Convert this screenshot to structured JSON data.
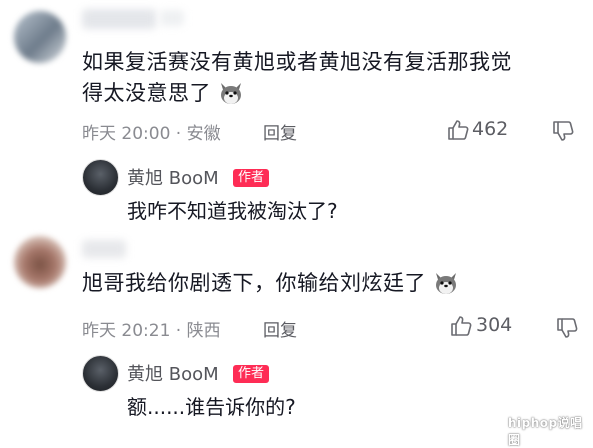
{
  "comments": [
    {
      "text_lines": [
        "如果复活赛没有黄旭或者黄旭没有复活那我觉",
        "得太没意思了"
      ],
      "emoji": "dog-emoji",
      "time": "昨天 20:00",
      "location": "安徽",
      "reply_label": "回复",
      "likes": "462",
      "reply": {
        "name": "黄旭 BooM",
        "badge": "作者",
        "text": "我咋不知道我被淘汰了?"
      }
    },
    {
      "text_lines": [
        "旭哥我给你剧透下，你输给刘炫廷了"
      ],
      "emoji": "dog-emoji",
      "time": "昨天 20:21",
      "location": "陕西",
      "reply_label": "回复",
      "likes": "304",
      "reply": {
        "name": "黄旭 BooM",
        "badge": "作者",
        "text": "额......谁告诉你的?"
      }
    }
  ],
  "watermark": "hiphop说唱圈",
  "colors": {
    "badge": "#fe2c55",
    "meta": "#8a8b91",
    "text": "#161823"
  }
}
